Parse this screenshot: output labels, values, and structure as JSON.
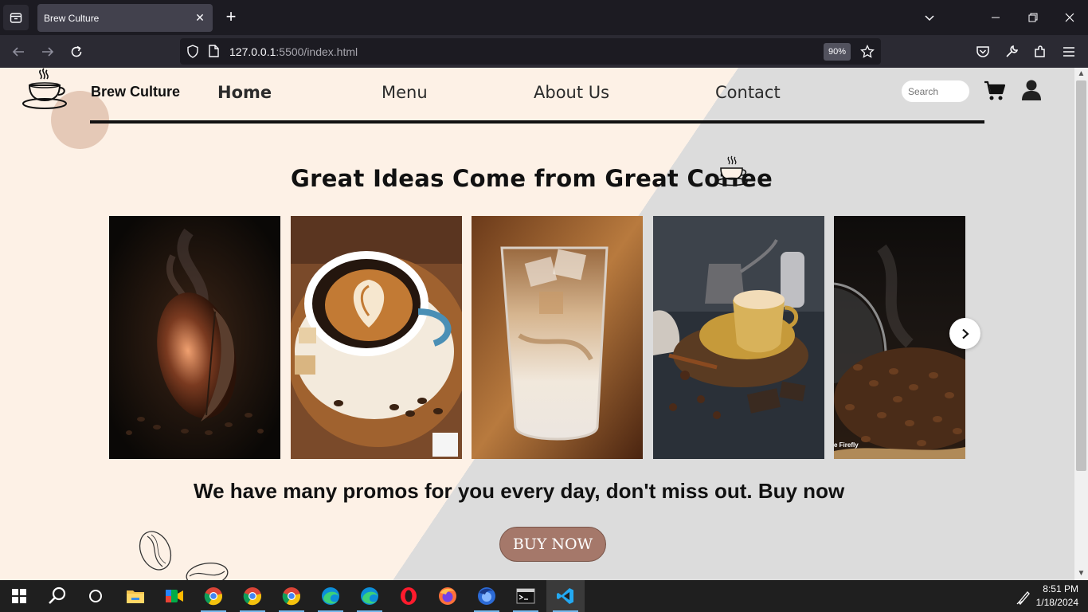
{
  "browser": {
    "tab_title": "Brew Culture",
    "url_host": "127.0.0.1",
    "url_rest": ":5500/index.html",
    "zoom": "90%"
  },
  "page": {
    "brand": "Brew Culture",
    "nav": [
      "Home",
      "Menu",
      "About Us",
      "Contact"
    ],
    "search_placeholder": "Search",
    "headline": "Great Ideas Come from Great Coffee",
    "slides": [
      {
        "name": "coffee bean in smoke",
        "watermark": ""
      },
      {
        "name": "latte art cup",
        "watermark": ""
      },
      {
        "name": "iced coffee glass",
        "watermark": ""
      },
      {
        "name": "coffee cup with spices",
        "watermark": ""
      },
      {
        "name": "spilled coffee beans",
        "watermark": "e Firefly"
      }
    ],
    "promo": "We have many promos for you every day, don't miss out. Buy now",
    "buy_button": "BUY NOW",
    "colors": {
      "page_bg": "#fdf1e6",
      "diagonal_bg": "#dcdcdc",
      "button": "#a5786a",
      "logo_blob": "#e5c9b7"
    }
  },
  "taskbar": {
    "apps": [
      "start",
      "search",
      "task-view",
      "file-explorer",
      "meet",
      "chrome",
      "chrome",
      "chrome",
      "edge",
      "edge",
      "opera",
      "firefox",
      "firefox-dev",
      "terminal",
      "vscode"
    ],
    "time": "8:51 PM",
    "date": "1/18/2024"
  }
}
